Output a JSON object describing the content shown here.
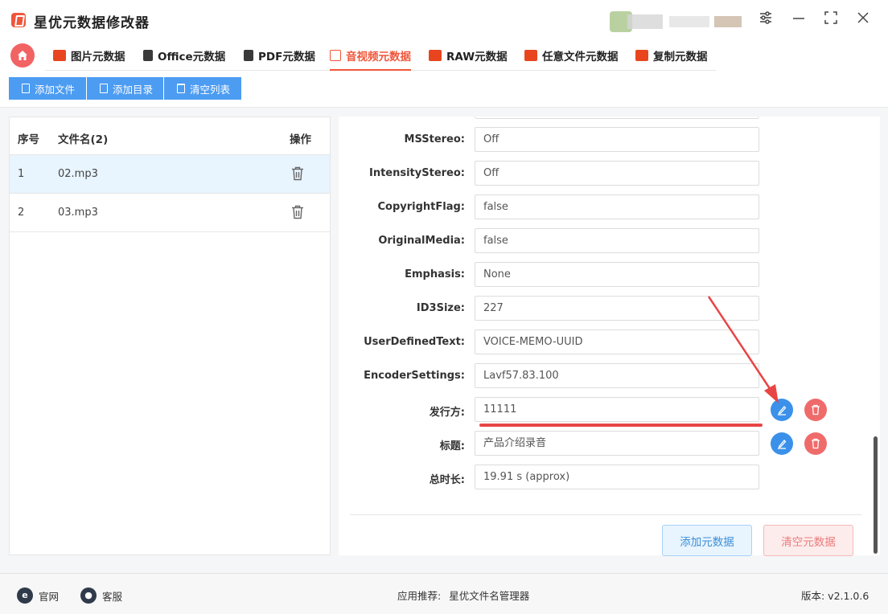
{
  "app": {
    "title": "星优元数据修改器"
  },
  "window": {
    "settings_icon": "sliders-icon",
    "minimize_icon": "minimize-icon",
    "maximize_icon": "maximize-icon",
    "close_icon": "close-icon"
  },
  "tabs": [
    {
      "label": "图片元数据",
      "icon": "image-icon",
      "color": "#e8451f"
    },
    {
      "label": "Office元数据",
      "icon": "stack-icon",
      "color": "#333333"
    },
    {
      "label": "PDF元数据",
      "icon": "stack-icon",
      "color": "#333333"
    },
    {
      "label": "音视频元数据",
      "icon": "play-icon",
      "color": "#f0563a",
      "active": true
    },
    {
      "label": "RAW元数据",
      "icon": "raw-icon",
      "color": "#e8451f"
    },
    {
      "label": "任意文件元数据",
      "icon": "file-icon",
      "color": "#e8451f"
    },
    {
      "label": "复制元数据",
      "icon": "copy-icon",
      "color": "#e8451f"
    }
  ],
  "toolbar": {
    "add_file": "添加文件",
    "add_dir": "添加目录",
    "clear_list": "清空列表"
  },
  "file_list": {
    "col_index": "序号",
    "col_name": "文件名(2)",
    "col_action": "操作",
    "rows": [
      {
        "index": "1",
        "name": "02.mp3",
        "selected": true
      },
      {
        "index": "2",
        "name": "03.mp3",
        "selected": false
      }
    ]
  },
  "metadata": [
    {
      "label": "MSStereo:",
      "value": "Off"
    },
    {
      "label": "IntensityStereo:",
      "value": "Off"
    },
    {
      "label": "CopyrightFlag:",
      "value": "false"
    },
    {
      "label": "OriginalMedia:",
      "value": "false"
    },
    {
      "label": "Emphasis:",
      "value": "None"
    },
    {
      "label": "ID3Size:",
      "value": "227"
    },
    {
      "label": "UserDefinedText:",
      "value": "VOICE-MEMO-UUID"
    },
    {
      "label": "EncoderSettings:",
      "value": "Lavf57.83.100"
    },
    {
      "label": "发行方:",
      "value": "11111",
      "editable": true
    },
    {
      "label": "标题:",
      "value": "产品介绍录音",
      "editable": true
    },
    {
      "label": "总时长:",
      "value": "19.91 s (approx)"
    }
  ],
  "panel": {
    "add_metadata": "添加元数据",
    "clear_metadata": "清空元数据"
  },
  "footer": {
    "website": "官网",
    "service": "客服",
    "recommend_label": "应用推荐:",
    "recommend_app": "星优文件名管理器",
    "version": "版本: v2.1.0.6"
  },
  "colors": {
    "accent": "#f0563a",
    "primary": "#4c9cf2",
    "danger": "#ef6b6b"
  }
}
